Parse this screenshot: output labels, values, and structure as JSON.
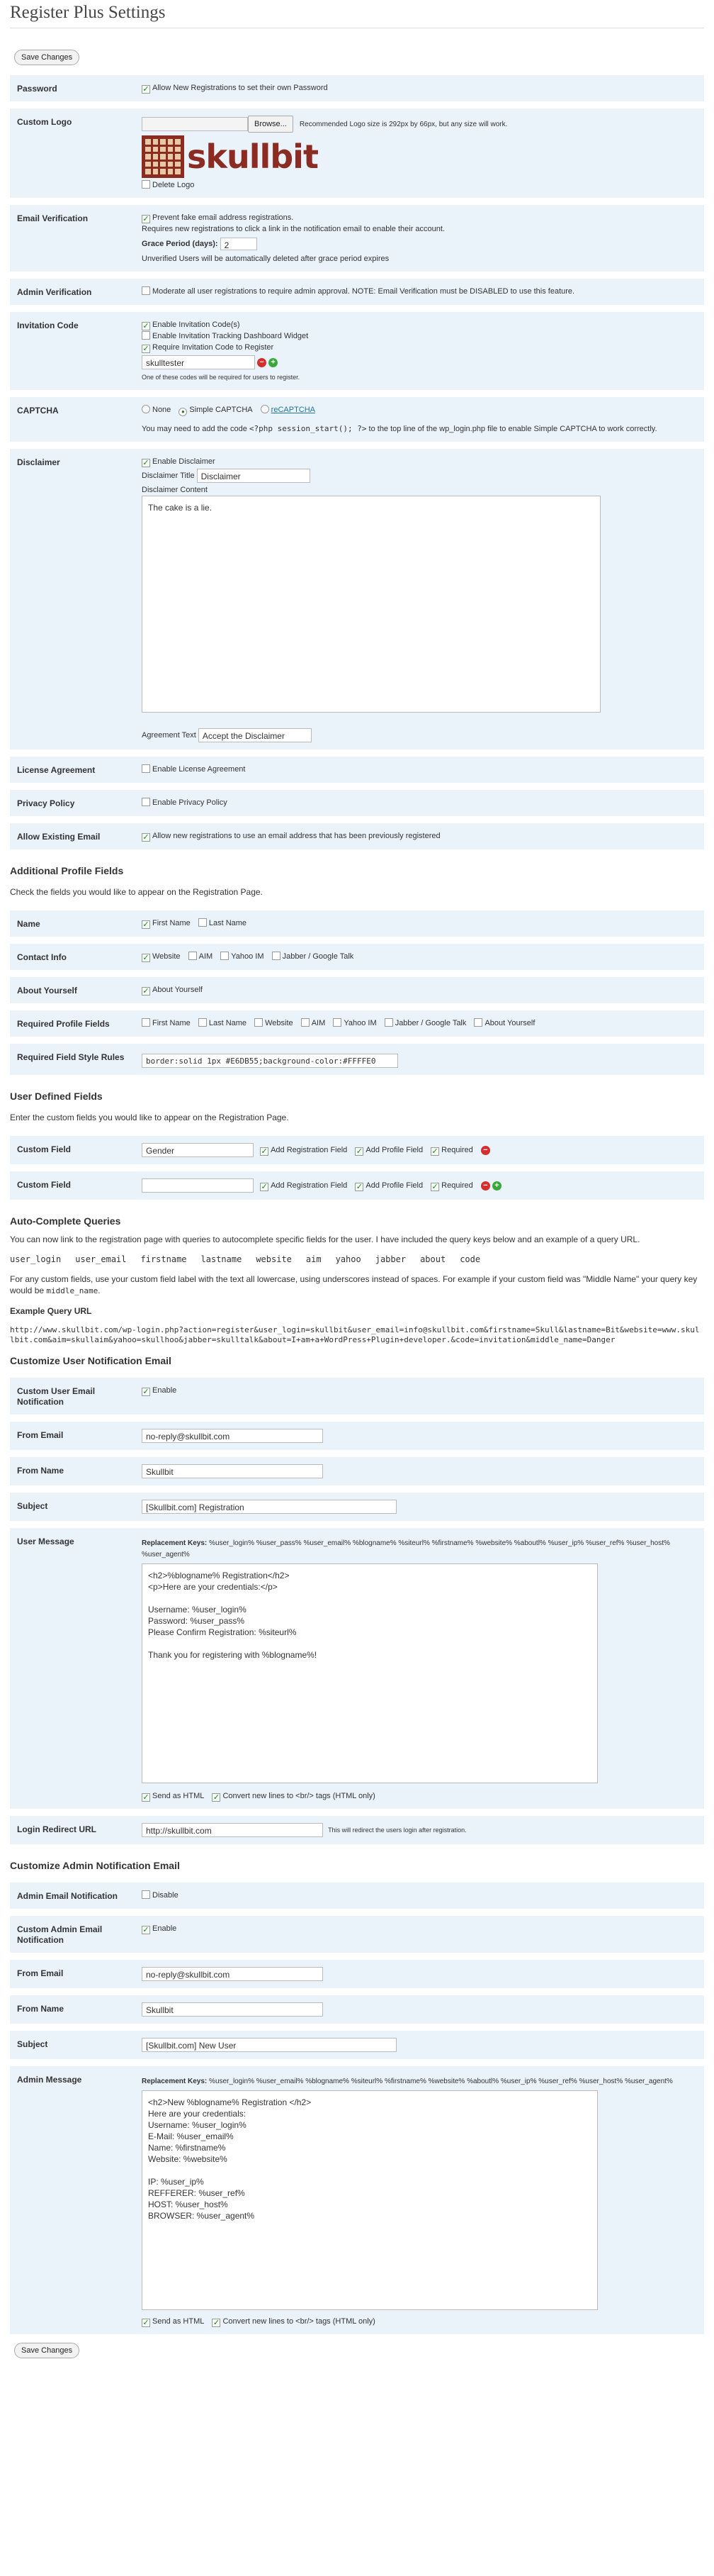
{
  "page": {
    "title": "Register Plus Settings",
    "save_label": "Save Changes"
  },
  "password": {
    "label": "Password",
    "option": "Allow New Registrations to set their own Password"
  },
  "logo": {
    "label": "Custom Logo",
    "browse_label": "Browse...",
    "hint": "Recommended Logo size is 292px by 66px, but any size will work.",
    "logo_text": "skullbit",
    "delete_label": "Delete Logo"
  },
  "email_verification": {
    "label": "Email Verification",
    "option": "Prevent fake email address registrations.",
    "note": "Requires new registrations to click a link in the notification email to enable their account.",
    "grace_label": "Grace Period (days):",
    "grace_value": "2",
    "grace_note": "Unverified Users will be automatically deleted after grace period expires"
  },
  "admin_verification": {
    "label": "Admin Verification",
    "option": "Moderate all user registrations to require admin approval. NOTE: Email Verification must be DISABLED to use this feature."
  },
  "invitation": {
    "label": "Invitation Code",
    "opt1": "Enable Invitation Code(s)",
    "opt2": "Enable Invitation Tracking Dashboard Widget",
    "opt3": "Require Invitation Code to Register",
    "code_value": "skulltester",
    "note": "One of these codes will be required for users to register."
  },
  "captcha": {
    "label": "CAPTCHA",
    "opt_none": "None",
    "opt_simple": "Simple CAPTCHA",
    "opt_re": "reCAPTCHA",
    "note_pre": "You may need to add the code",
    "note_code": "<?php session_start(); ?>",
    "note_post": "to the top line of the wp_login.php file to enable Simple CAPTCHA to work correctly."
  },
  "disclaimer": {
    "label": "Disclaimer",
    "enable": "Enable Disclaimer",
    "title_label": "Disclaimer Title",
    "title_value": "Disclaimer",
    "content_label": "Disclaimer Content",
    "content_value": "The cake is a lie.",
    "agreement_label": "Agreement Text",
    "agreement_value": "Accept the Disclaimer"
  },
  "license": {
    "label": "License Agreement",
    "option": "Enable License Agreement"
  },
  "privacy": {
    "label": "Privacy Policy",
    "option": "Enable Privacy Policy"
  },
  "existing_email": {
    "label": "Allow Existing Email",
    "option": "Allow new registrations to use an email address that has been previously registered"
  },
  "additional_fields": {
    "heading": "Additional Profile Fields",
    "desc": "Check the fields you would like to appear on the Registration Page.",
    "name_label": "Name",
    "first_name": "First Name",
    "last_name": "Last Name",
    "contact_label": "Contact Info",
    "website": "Website",
    "aim": "AIM",
    "yahoo": "Yahoo IM",
    "jabber": "Jabber / Google Talk",
    "about_label": "About Yourself",
    "about_option": "About Yourself",
    "required_label": "Required Profile Fields",
    "style_label": "Required Field Style Rules",
    "style_value": "border:solid 1px #E6DB55;background-color:#FFFFE0"
  },
  "user_defined": {
    "heading": "User Defined Fields",
    "desc": "Enter the custom fields you would like to appear on the Registration Page.",
    "field_label": "Custom Field",
    "field1_value": "Gender",
    "field2_value": "",
    "add_reg": "Add Registration Field",
    "add_profile": "Add Profile Field",
    "required": "Required"
  },
  "autocomplete": {
    "heading": "Auto-Complete Queries",
    "desc": "You can now link to the registration page with queries to autocomplete specific fields for the user. I have included the query keys below and an example of a query URL.",
    "keys": [
      "user_login",
      "user_email",
      "firstname",
      "lastname",
      "website",
      "aim",
      "yahoo",
      "jabber",
      "about",
      "code"
    ],
    "custom_note_pre": "For any custom fields, use your custom field label with the text all lowercase, using underscores instead of spaces. For example if your custom field was \"Middle Name\" your query key would be",
    "custom_note_key": "middle_name",
    "example_label": "Example Query URL",
    "example_url": "http://www.skullbit.com/wp-login.php?action=register&user_login=skullbit&user_email=info@skullbit.com&firstname=Skull&lastname=Bit&website=www.skullbit.com&aim=skullaim&yahoo=skullhoo&jabber=skulltalk&about=I+am+a+WordPress+Plugin+developer.&code=invitation&middle_name=Danger"
  },
  "user_notification": {
    "heading": "Customize User Notification Email",
    "custom_label": "Custom User Email Notification",
    "enable": "Enable",
    "from_email_label": "From Email",
    "from_email_value": "no-reply@skullbit.com",
    "from_name_label": "From Name",
    "from_name_value": "Skullbit",
    "subject_label": "Subject",
    "subject_value": "[Skullbit.com] Registration",
    "message_label": "User Message",
    "keys_title": "Replacement Keys:",
    "keys": "%user_login%  %user_pass%  %user_email%  %blogname%  %siteurl%  %firstname%  %website%  %aboutl%  %user_ip%  %user_ref%  %user_host%  %user_agent%",
    "message_value": "<h2>%blogname% Registration</h2>\n<p>Here are your credentials:</p>\n\nUsername: %user_login%\nPassword: %user_pass%\nPlease Confirm Registration: %siteurl%\n\nThank you for registering with %blogname%!",
    "send_html": "Send as HTML",
    "convert_nl": "Convert new lines to <br/> tags (HTML only)",
    "redirect_label": "Login Redirect URL",
    "redirect_value": "http://skullbit.com",
    "redirect_note": "This will redirect the users login after registration."
  },
  "admin_notification": {
    "heading": "Customize Admin Notification Email",
    "email_label": "Admin Email Notification",
    "disable": "Disable",
    "custom_label": "Custom Admin Email Notification",
    "enable": "Enable",
    "from_email_label": "From Email",
    "from_email_value": "no-reply@skullbit.com",
    "from_name_label": "From Name",
    "from_name_value": "Skullbit",
    "subject_label": "Subject",
    "subject_value": "[Skullbit.com] New User",
    "message_label": "Admin Message",
    "keys_title": "Replacement Keys:",
    "keys": "%user_login%  %user_email%  %blogname%  %siteurl%  %firstname%  %website%  %aboutl%  %user_ip%  %user_ref%  %user_host%  %user_agent%",
    "message_value": "<h2>New %blogname% Registration </h2>\nHere are your credentials:\nUsername: %user_login%\nE-Mail: %user_email%\nName: %firstname%\nWebsite: %website%\n\nIP: %user_ip%\nREFFERER: %user_ref%\nHOST: %user_host%\nBROWSER: %user_agent%",
    "send_html": "Send as HTML",
    "convert_nl": "Convert new lines to <br/> tags (HTML only)"
  },
  "colors": {
    "row_bg": "#eaf2fa",
    "logo_brand": "#8b2b22",
    "delete": "#d62d2d",
    "add": "#39a83b"
  },
  "icons": {
    "delete": "delete-icon",
    "add": "add-icon",
    "check": "checkbox-check-icon"
  }
}
